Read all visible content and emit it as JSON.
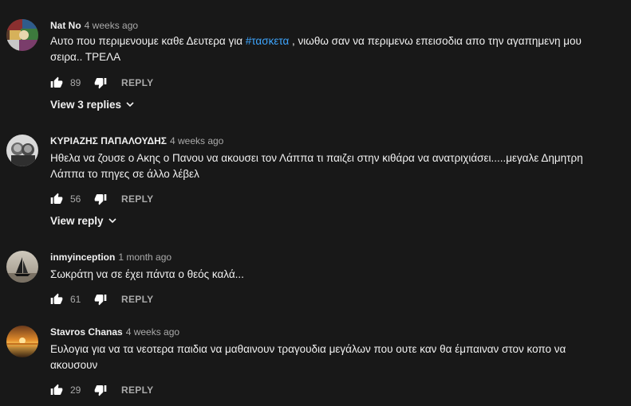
{
  "comments": [
    {
      "author": "Nat No",
      "time": "4 weeks ago",
      "text_before": "Αυτο που περιμενουμε καθε Δευτερα για ",
      "hashtag": "#τασκετα",
      "text_after": " , νιωθω σαν να περιμενω επεισοδια απο την αγαπημενη μου σειρα.. ΤΡΕΛΑ",
      "likes": "89",
      "reply_label": "REPLY",
      "view_replies": "View 3 replies",
      "avatar": "colorful-collage-avatar"
    },
    {
      "author": "ΚΥΡΙΑΖΗΣ ΠΑΠΑΛΟΥΔΗΣ",
      "time": "4 weeks ago",
      "text": "Ηθελα να ζουσε ο Ακης ο Πανου να ακουσει τον Λάππα τι παιζει στην κιθάρα να ανατριχιάσει.....μεγαλε Δημητρη Λάππα το πηγες σε άλλο λέβελ",
      "likes": "56",
      "reply_label": "REPLY",
      "view_replies": "View reply",
      "avatar": "grayscale-two-faces-avatar"
    },
    {
      "author": "inmyinception",
      "time": "1 month ago",
      "text": "Σωκράτη να σε έχει πάντα ο θεός καλά...",
      "likes": "61",
      "reply_label": "REPLY",
      "avatar": "sailboat-avatar"
    },
    {
      "author": "Stavros Chanas",
      "time": "4 weeks ago",
      "text": "Ευλογια για να τα νεοτερα παιδια να μαθαινουν τραγουδια μεγάλων που ουτε καν θα έμπαιναν στον κοπο να ακουσουν",
      "likes": "29",
      "reply_label": "REPLY",
      "avatar": "sunset-sea-avatar"
    }
  ],
  "colors": {
    "background": "#181818",
    "text": "#f1f1f1",
    "secondary": "#aaaaaa",
    "hashtag": "#3ea6ff"
  },
  "icons": {
    "like": "thumb-up-icon",
    "dislike": "thumb-down-icon",
    "expand": "chevron-down-icon"
  }
}
